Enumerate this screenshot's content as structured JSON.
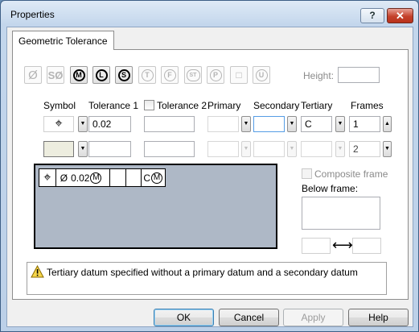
{
  "window": {
    "title": "Properties",
    "help_glyph": "?",
    "close_glyph": "✕"
  },
  "tab": {
    "label": "Geometric Tolerance"
  },
  "symbol_buttons": [
    {
      "name": "diameter",
      "glyph": "Ø",
      "active": false
    },
    {
      "name": "spherical-diameter",
      "glyph": "SØ",
      "active": false
    },
    {
      "name": "mmc",
      "glyph": "M",
      "active": true
    },
    {
      "name": "lmc",
      "glyph": "L",
      "active": true
    },
    {
      "name": "rfs",
      "glyph": "S",
      "active": true
    },
    {
      "name": "tangent-plane",
      "glyph": "T",
      "active": false
    },
    {
      "name": "free-state",
      "glyph": "F",
      "active": false
    },
    {
      "name": "statistical",
      "glyph": "ST",
      "active": false
    },
    {
      "name": "projected",
      "glyph": "P",
      "active": false
    },
    {
      "name": "square",
      "glyph": "□",
      "active": false
    },
    {
      "name": "unilateral",
      "glyph": "U",
      "active": false
    }
  ],
  "height": {
    "label": "Height:",
    "value": ""
  },
  "columns": {
    "symbol": "Symbol",
    "tolerance1": "Tolerance 1",
    "tolerance2": "Tolerance 2",
    "primary": "Primary",
    "secondary": "Secondary",
    "tertiary": "Tertiary",
    "frames": "Frames"
  },
  "row1": {
    "symbol_glyph": "⌖",
    "tolerance1": "0.02",
    "tolerance2": "",
    "primary": "",
    "secondary": "",
    "tertiary": "C",
    "frames": "1"
  },
  "row2": {
    "tolerance1": "",
    "tolerance2": "",
    "primary": "",
    "secondary": "",
    "tertiary": "",
    "frames": "2"
  },
  "dropdown_glyph": "▼",
  "spin_glyph": "▲",
  "preview": {
    "symbol": "⌖",
    "tolerance_prefix": "Ø",
    "tolerance_value": "0.02",
    "tolerance_modifier": "M",
    "tertiary": "C",
    "tertiary_modifier": "M"
  },
  "composite": {
    "label": "Composite frame",
    "checked": false
  },
  "below_frame": {
    "label": "Below frame:",
    "value": ""
  },
  "arrow_glyph": "⟷",
  "message": {
    "text": "Tertiary datum specified without a primary datum and a secondary datum",
    "icon": "warning-icon"
  },
  "buttons": {
    "ok": "OK",
    "cancel": "Cancel",
    "apply": "Apply",
    "help": "Help"
  }
}
